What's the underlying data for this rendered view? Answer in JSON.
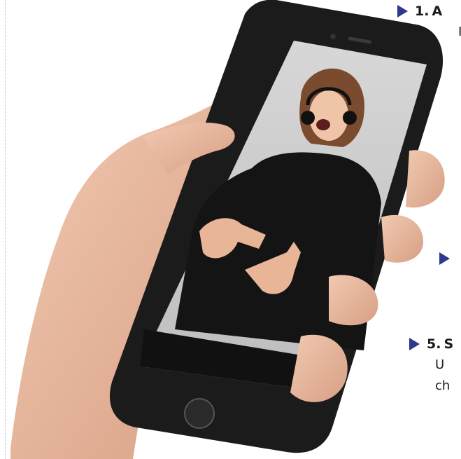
{
  "bullets": [
    {
      "number": "1.",
      "title": "A"
    },
    {
      "number": "",
      "title": ""
    },
    {
      "number": "5.",
      "title": "S"
    }
  ],
  "line_after_1": "I",
  "line_after_5a": "U",
  "line_after_5b": "ch",
  "colors": {
    "bullet_triangle": "#2d3a8c",
    "phone_body": "#1b1b1b",
    "screen_bg": "#cfcfcf",
    "skin": "#e7b69a"
  },
  "image_description_icons": [
    "phone-icon",
    "home-button-icon",
    "headset-icon"
  ]
}
